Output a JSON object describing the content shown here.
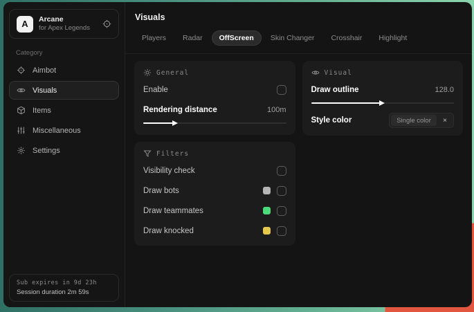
{
  "app": {
    "logo_letter": "A",
    "name": "Arcane",
    "subtitle": "for Apex Legends"
  },
  "sidebar": {
    "category_label": "Category",
    "items": [
      {
        "label": "Aimbot",
        "icon": "crosshair-icon",
        "selected": false
      },
      {
        "label": "Visuals",
        "icon": "eye-icon",
        "selected": true
      },
      {
        "label": "Items",
        "icon": "package-icon",
        "selected": false
      },
      {
        "label": "Miscellaneous",
        "icon": "sliders-icon",
        "selected": false
      },
      {
        "label": "Settings",
        "icon": "gear-icon",
        "selected": false
      }
    ],
    "footer": {
      "sub_expires": "Sub expires in 9d 23h",
      "session_duration": "Session duration 2m 59s"
    }
  },
  "main": {
    "title": "Visuals",
    "tabs": [
      {
        "label": "Players",
        "selected": false
      },
      {
        "label": "Radar",
        "selected": false
      },
      {
        "label": "OffScreen",
        "selected": true
      },
      {
        "label": "Skin Changer",
        "selected": false
      },
      {
        "label": "Crosshair",
        "selected": false
      },
      {
        "label": "Highlight",
        "selected": false
      }
    ],
    "cards": {
      "general": {
        "title": "General",
        "enable_label": "Enable",
        "enable_checked": false,
        "distance_label": "Rendering distance",
        "distance_value": "100m",
        "distance_slider_pct": 21
      },
      "visual": {
        "title": "Visual",
        "outline_label": "Draw outline",
        "outline_value": "128.0",
        "outline_slider_pct": 48,
        "style_label": "Style color",
        "style_value": "Single color",
        "style_clear": "×"
      },
      "filters": {
        "title": "Filters",
        "rows": [
          {
            "label": "Visibility check",
            "swatch": null,
            "checked": false
          },
          {
            "label": "Draw bots",
            "swatch": "#b5b5b5",
            "checked": false
          },
          {
            "label": "Draw teammates",
            "swatch": "#4cd97b",
            "checked": false
          },
          {
            "label": "Draw knocked",
            "swatch": "#e6c84e",
            "checked": false
          }
        ]
      }
    }
  },
  "colors": {
    "accent_green": "#4cd97b",
    "accent_yellow": "#e6c84e",
    "swatch_gray": "#b5b5b5",
    "bg_window": "#141414",
    "bg_card": "#1c1c1c"
  }
}
